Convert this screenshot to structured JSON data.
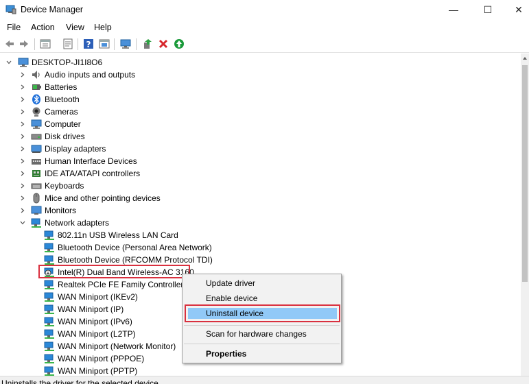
{
  "window": {
    "title": "Device Manager",
    "minimize_glyph": "—",
    "maximize_glyph": "☐",
    "close_glyph": "✕"
  },
  "menubar": {
    "items": [
      "File",
      "Action",
      "View",
      "Help"
    ]
  },
  "toolbar": {
    "icons": [
      "back-arrow-icon",
      "forward-arrow-icon",
      "properties-icon",
      "driver-details-icon",
      "help-icon",
      "action-icon",
      "monitor-scan-icon",
      "update-driver-icon",
      "uninstall-x-icon",
      "enable-device-icon"
    ]
  },
  "tree": {
    "root": "DESKTOP-JI1I8O6",
    "categories": [
      "Audio inputs and outputs",
      "Batteries",
      "Bluetooth",
      "Cameras",
      "Computer",
      "Disk drives",
      "Display adapters",
      "Human Interface Devices",
      "IDE ATA/ATAPI controllers",
      "Keyboards",
      "Mice and other pointing devices",
      "Monitors",
      "Network adapters"
    ],
    "network_adapters": [
      "802.11n USB Wireless LAN Card",
      "Bluetooth Device (Personal Area Network)",
      "Bluetooth Device (RFCOMM Protocol TDI)",
      "Intel(R) Dual Band Wireless-AC 3160",
      "Realtek PCIe FE Family Controller",
      "WAN Miniport (IKEv2)",
      "WAN Miniport (IP)",
      "WAN Miniport (IPv6)",
      "WAN Miniport (L2TP)",
      "WAN Miniport (Network Monitor)",
      "WAN Miniport (PPPOE)",
      "WAN Miniport (PPTP)"
    ]
  },
  "context_menu": {
    "update_driver": "Update driver",
    "enable_device": "Enable device",
    "uninstall_device": "Uninstall device",
    "scan_hardware": "Scan for hardware changes",
    "properties": "Properties"
  },
  "status": {
    "text": "Uninstalls the driver for the selected device."
  },
  "colors": {
    "highlight_border": "#d9303f",
    "menu_highlight": "#91c9f7",
    "net_icon_blue": "#2b88d8"
  }
}
